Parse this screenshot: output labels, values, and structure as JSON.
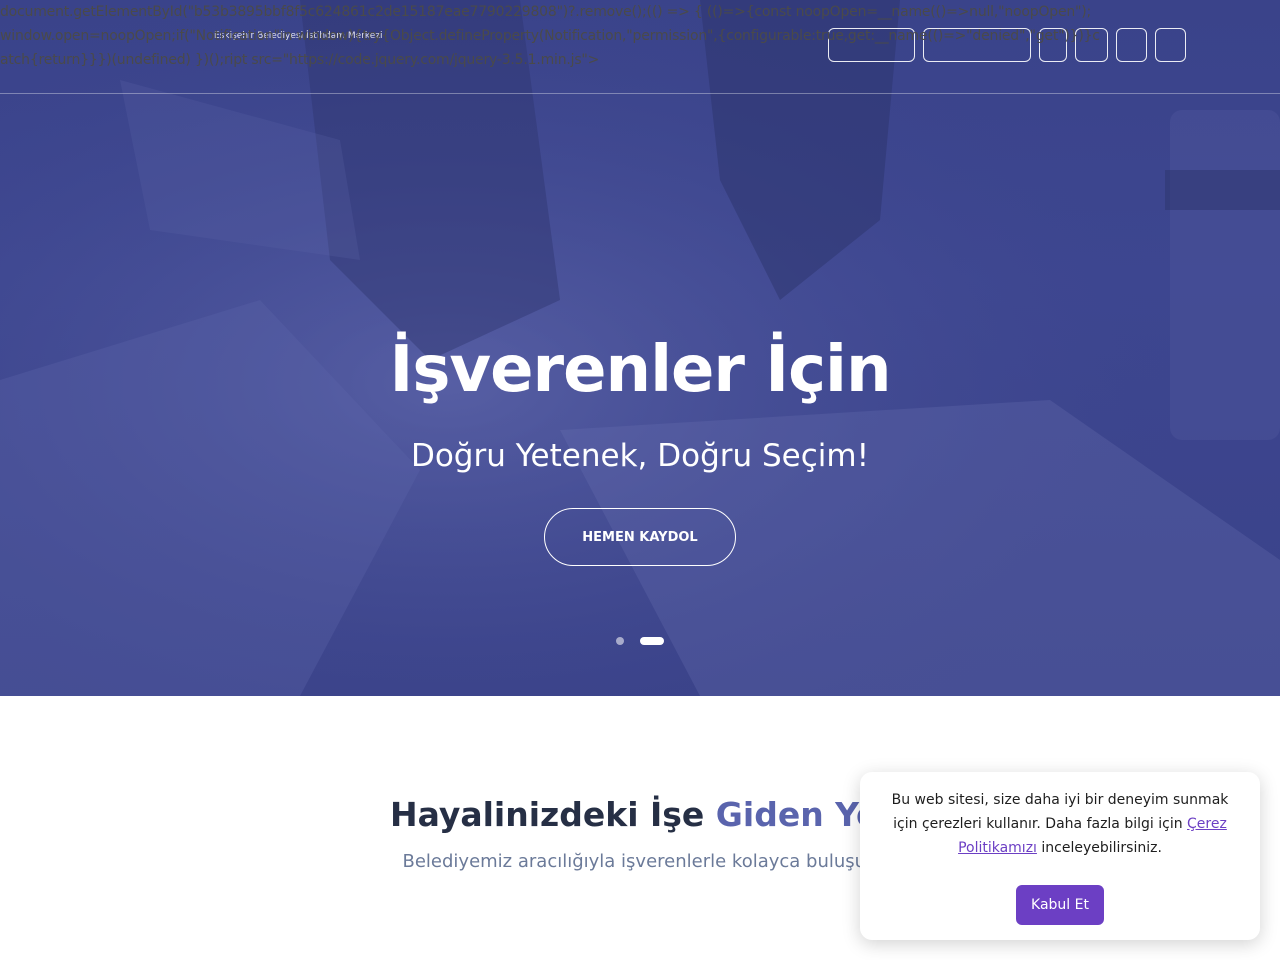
{
  "leaked_script_text": "document.getElementById(\"b53b3895bbf8f5c624861c2de15187eae7790229808\")?.remove();(() => { (()=>{const noopOpen=__name(()=>null,\"noopOpen\");window.open=noopOpen;if(\"Notification\"in window){try{Object.defineProperty(Notification,\"permission\",{configurable:true,get:__name(()=>\"denied\",\"get\")})}catch{return}}})(undefined) })();ript src=\"https://code.jquery.com/jquery-3.5.1.min.js\">",
  "header": {
    "logo_text": "",
    "logo_tagline": "Eskişehir Belediyesi İstihdam Merkezi",
    "nav_buttons": [
      {
        "label": ""
      },
      {
        "label": ""
      },
      {
        "label": ""
      },
      {
        "label": ""
      },
      {
        "label": ""
      },
      {
        "label": ""
      }
    ]
  },
  "hero": {
    "title": "İşverenler İçin",
    "subtitle": "Doğru Yetenek, Doğru Seçim!",
    "cta_label": "HEMEN KAYDOL",
    "slides_count": 2,
    "active_slide": 2
  },
  "section": {
    "title_part1": "Hayalinizdeki İşe ",
    "title_accent": "Giden Yol",
    "subtitle": "Belediyemiz aracılığıyla işverenlerle kolayca buluşun"
  },
  "cookie_banner": {
    "text_before_link": "Bu web sitesi, size daha iyi bir deneyim sunmak için çerezleri kullanır. Daha fazla bilgi için ",
    "link_text": "Çerez Politikamızı",
    "text_after_link": " inceleyebilirsiniz.",
    "accept_label": "Kabul Et"
  },
  "colors": {
    "hero_overlay": "#3b448c",
    "section_title": "#262f45",
    "accent": "#5a64ad",
    "cookie_button": "#6c3fc4"
  }
}
